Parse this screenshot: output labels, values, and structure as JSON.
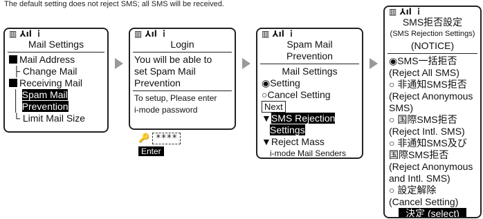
{
  "note": "The default setting does not reject SMS; all SMS will be received.",
  "s1": {
    "title": "Mail Settings",
    "items": [
      "Mail Address",
      "Change Mail",
      "Receiving Mail",
      "Spam Mail",
      "Prevention",
      "Limit Mail Size"
    ]
  },
  "s2": {
    "title": "Login",
    "body": [
      "You will be able to",
      "set Spam Mail",
      "Prevention"
    ],
    "prompt": [
      "To setup, Please enter",
      "i-mode password"
    ],
    "password": "****",
    "enter": "Enter"
  },
  "s3": {
    "title": [
      "Spam Mail",
      "Prevention"
    ],
    "section": "Mail Settings",
    "opt_setting": "Setting",
    "opt_cancel": "Cancel Setting",
    "next": "Next",
    "links": [
      "SMS Rejection",
      "Settings",
      "Reject Mass",
      "i-mode Mail Senders"
    ]
  },
  "s4": {
    "title": "SMS拒否設定",
    "subtitle": "(SMS Rejection Settings)",
    "notice": "(NOTICE)",
    "lines": [
      "SMS一括拒否",
      "(Reject All SMS)",
      "非通知SMS拒否",
      "(Reject Anonymous",
      "SMS)",
      "国際SMS拒否",
      "(Reject Intl. SMS)",
      "非通知SMS及び",
      "国際SMS拒否",
      "(Reject Anonymous",
      "and Intl. SMS)",
      "設定解除",
      "(Cancel Setting)"
    ],
    "select": "決定 (select)"
  }
}
